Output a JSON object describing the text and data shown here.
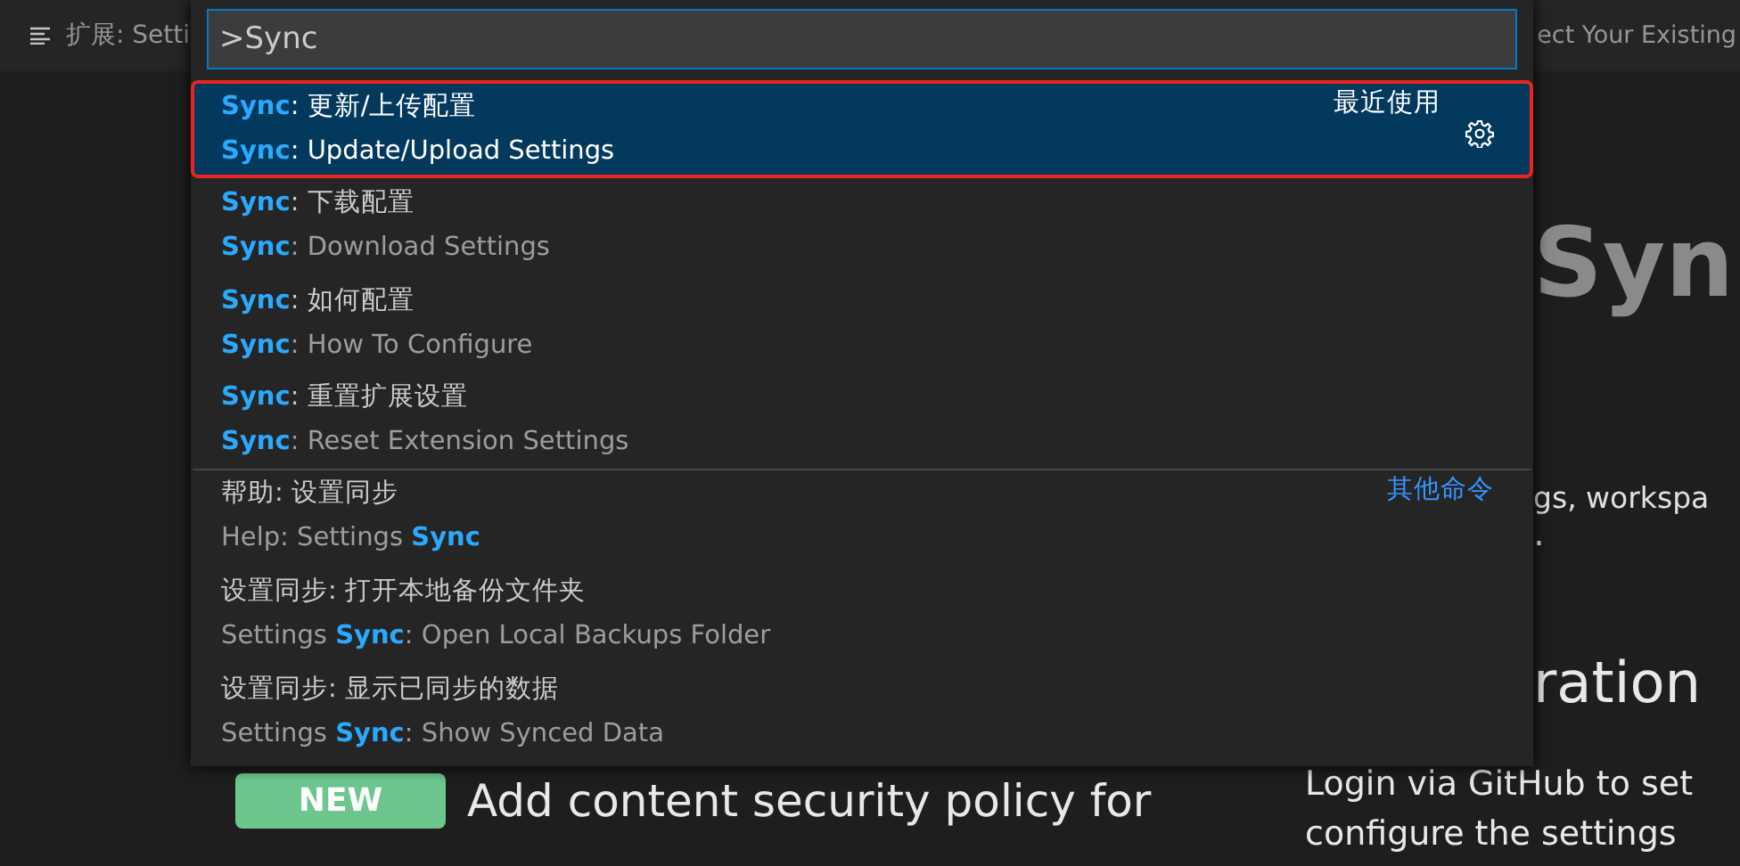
{
  "tab": {
    "title": "扩展: Setti"
  },
  "header_fragment": "ect Your Existing",
  "palette": {
    "input": {
      "value": ">Sync"
    },
    "commands": [
      {
        "label": "**Sync**: 更新/上传配置",
        "detail": "**Sync**: Update/Upload Settings",
        "group": "最近使用",
        "selected": true,
        "outlined": true,
        "separator": false
      },
      {
        "label": "**Sync**: 下载配置",
        "detail": "**Sync**: Download Settings",
        "selected": false,
        "outlined": false,
        "separator": false
      },
      {
        "label": "**Sync**: 如何配置",
        "detail": "**Sync**: How To Configure",
        "selected": false,
        "outlined": false,
        "separator": false
      },
      {
        "label": "**Sync**: 重置扩展设置",
        "detail": "**Sync**: Reset Extension Settings",
        "selected": false,
        "outlined": false,
        "separator": false
      },
      {
        "label": "帮助: 设置同步",
        "detail": "Help: Settings **Sync**",
        "group": "其他命令",
        "selected": false,
        "outlined": false,
        "separator": true
      },
      {
        "label": "设置同步: 打开本地备份文件夹",
        "detail": "Settings **Sync**: Open Local Backups Folder",
        "selected": false,
        "outlined": false,
        "separator": false
      },
      {
        "label": "设置同步: 显示已同步的数据",
        "detail": "Settings **Sync**: Show Synced Data",
        "selected": false,
        "outlined": false,
        "separator": false
      }
    ]
  },
  "page": {
    "heading": "Syn",
    "intro": "gs, workspa",
    "intro_end": ".",
    "section_heading": "ration"
  },
  "feature": {
    "badge": "NEW",
    "title": "Add content security policy for"
  },
  "login_text": [
    "Login via GitHub to set",
    "configure the settings"
  ]
}
